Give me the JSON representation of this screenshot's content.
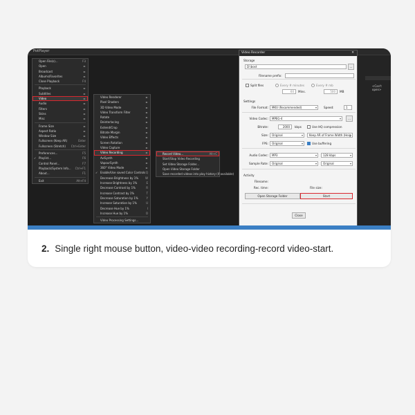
{
  "app": {
    "title": "PotPlayer"
  },
  "right_panel": {
    "text": "<Can't open>"
  },
  "main_menu": [
    {
      "label": "Open File(s)...",
      "shortcut": "F3"
    },
    {
      "label": "Open",
      "shortcut": "►"
    },
    {
      "label": "Broadcast",
      "shortcut": "►"
    },
    {
      "label": "Albums/Favorites",
      "shortcut": "►"
    },
    {
      "label": "Close Playback",
      "shortcut": "F4"
    },
    {
      "sep": true
    },
    {
      "label": "Playback",
      "shortcut": "►"
    },
    {
      "label": "Subtitles",
      "shortcut": "►"
    },
    {
      "label": "Video",
      "shortcut": "►",
      "highlight": true
    },
    {
      "label": "Audio",
      "shortcut": "►"
    },
    {
      "label": "Filters",
      "shortcut": "►"
    },
    {
      "label": "Skins",
      "shortcut": "►"
    },
    {
      "label": "Misc",
      "shortcut": "►"
    },
    {
      "sep": true
    },
    {
      "label": "Frame Size",
      "shortcut": "►"
    },
    {
      "label": "Aspect Ratio",
      "shortcut": "►"
    },
    {
      "label": "Window Size",
      "shortcut": "►"
    },
    {
      "label": "Fullscreen (Keep AR)",
      "shortcut": "Enter"
    },
    {
      "label": "Fullscreen (Stretch)",
      "shortcut": "Ctrl+Enter"
    },
    {
      "sep": true
    },
    {
      "label": "Preferences...",
      "shortcut": "F5"
    },
    {
      "label": "Playlist...",
      "shortcut": "F6",
      "checked": true
    },
    {
      "label": "Control Panel...",
      "shortcut": "F7"
    },
    {
      "label": "Playback/System Info...",
      "shortcut": "Ctrl+F1"
    },
    {
      "label": "About...",
      "shortcut": "F1"
    },
    {
      "sep": true
    },
    {
      "label": "Exit",
      "shortcut": "Alt+F4"
    }
  ],
  "video_menu": [
    {
      "label": "Video Renderer",
      "shortcut": "►"
    },
    {
      "label": "Pixel Shaders",
      "shortcut": "►"
    },
    {
      "label": "3D Video Mode",
      "shortcut": "►"
    },
    {
      "label": "Video Transform Filter",
      "shortcut": "►"
    },
    {
      "label": "Rotate",
      "shortcut": "►"
    },
    {
      "label": "Deinterlacing",
      "shortcut": "►"
    },
    {
      "label": "Extend/Crop",
      "shortcut": "►"
    },
    {
      "label": "Bitrate Margin",
      "shortcut": "►"
    },
    {
      "label": "Video Effects",
      "shortcut": "►"
    },
    {
      "label": "Screen Rotation",
      "shortcut": "►"
    },
    {
      "label": "Video Capture",
      "shortcut": "►"
    },
    {
      "label": "Video Recording",
      "shortcut": "►",
      "highlight": true
    },
    {
      "label": "AviSynth",
      "shortcut": "►"
    },
    {
      "label": "VapourSynth",
      "shortcut": "►"
    },
    {
      "label": "360° Video Mode",
      "shortcut": "►"
    },
    {
      "label": "Enable/Use saved Color Controls",
      "shortcut": "Q",
      "checked": true
    },
    {
      "label": "Decrease Brightness by 1%",
      "shortcut": "W"
    },
    {
      "label": "Increase Brightness by 1%",
      "shortcut": "E"
    },
    {
      "label": "Decrease Contrast by 1%",
      "shortcut": "R"
    },
    {
      "label": "Increase Contrast by 1%",
      "shortcut": "T"
    },
    {
      "label": "Decrease Saturation by 1%",
      "shortcut": "Y"
    },
    {
      "label": "Increase Saturation by 1%",
      "shortcut": "U"
    },
    {
      "label": "Decrease Hue by 1%",
      "shortcut": "I"
    },
    {
      "label": "Increase Hue by 1%",
      "shortcut": "O"
    },
    {
      "sep": true
    },
    {
      "label": "Video Processing Settings...",
      "shortcut": ""
    }
  ],
  "recording_menu": [
    {
      "label": "Record Video...",
      "shortcut": "Alt+C",
      "highlight": true
    },
    {
      "label": "Start/Stop Video Recording",
      "shortcut": ""
    },
    {
      "label": "Set Video Storage Folder...",
      "shortcut": ""
    },
    {
      "label": "Open Video Storage Folder",
      "shortcut": ""
    },
    {
      "label": "Save recorded videos into play history (if available)",
      "shortcut": ""
    }
  ],
  "dialog": {
    "title": "Video Recorder",
    "storage_section": "Storage",
    "storage_path": "D:\\bost",
    "browse": "...",
    "filename_prefix_label": "Filename prefix:",
    "split_files_label": "Split files",
    "every_minutes": "Every # minutes",
    "every_mb": "Every # mb",
    "minutes_value": "60",
    "mins_unit": "Mins.",
    "mb_value": "500",
    "mb_unit": "MB",
    "settings_section": "Settings",
    "file_format_label": "File Format:",
    "file_format_value": "MKV (Recommended)",
    "speed_label": "Speed:",
    "speed_value": "1",
    "video_codec_label": "Video Codec:",
    "video_codec_value": "MPEG-4",
    "bitrate_label": "Bitrate:",
    "bitrate_value": "2000",
    "kbps": "kbps",
    "hq_label": "Use HQ compression",
    "size_label": "Size:",
    "size_value": "Original",
    "size_mode": "Keep AR of Frame Width (Heig",
    "fps_label": "FPS:",
    "fps_value": "Original",
    "buffering_label": "Use buffering",
    "audio_codec_label": "Audio Codec:",
    "audio_codec_value": "MP3",
    "audio_bitrate": "128 kbps",
    "sample_rate_label": "Sample Rate:",
    "sample_rate_value": "Original",
    "channels_value": "Original",
    "activity_section": "Activity",
    "filename_label": "Filename:",
    "rec_time_label": "Rec. time:",
    "file_size_label": "File size:",
    "open_folder_btn": "Open Storage Folder",
    "start_btn": "Start",
    "close_btn": "Close"
  },
  "caption": {
    "number": "2.",
    "text": "Single right mouse button, video-video recording-record video-start."
  },
  "colors": {
    "highlight": "#d9272e",
    "accent": "#3b7fc4",
    "dark_bg": "#1d1d1d"
  }
}
